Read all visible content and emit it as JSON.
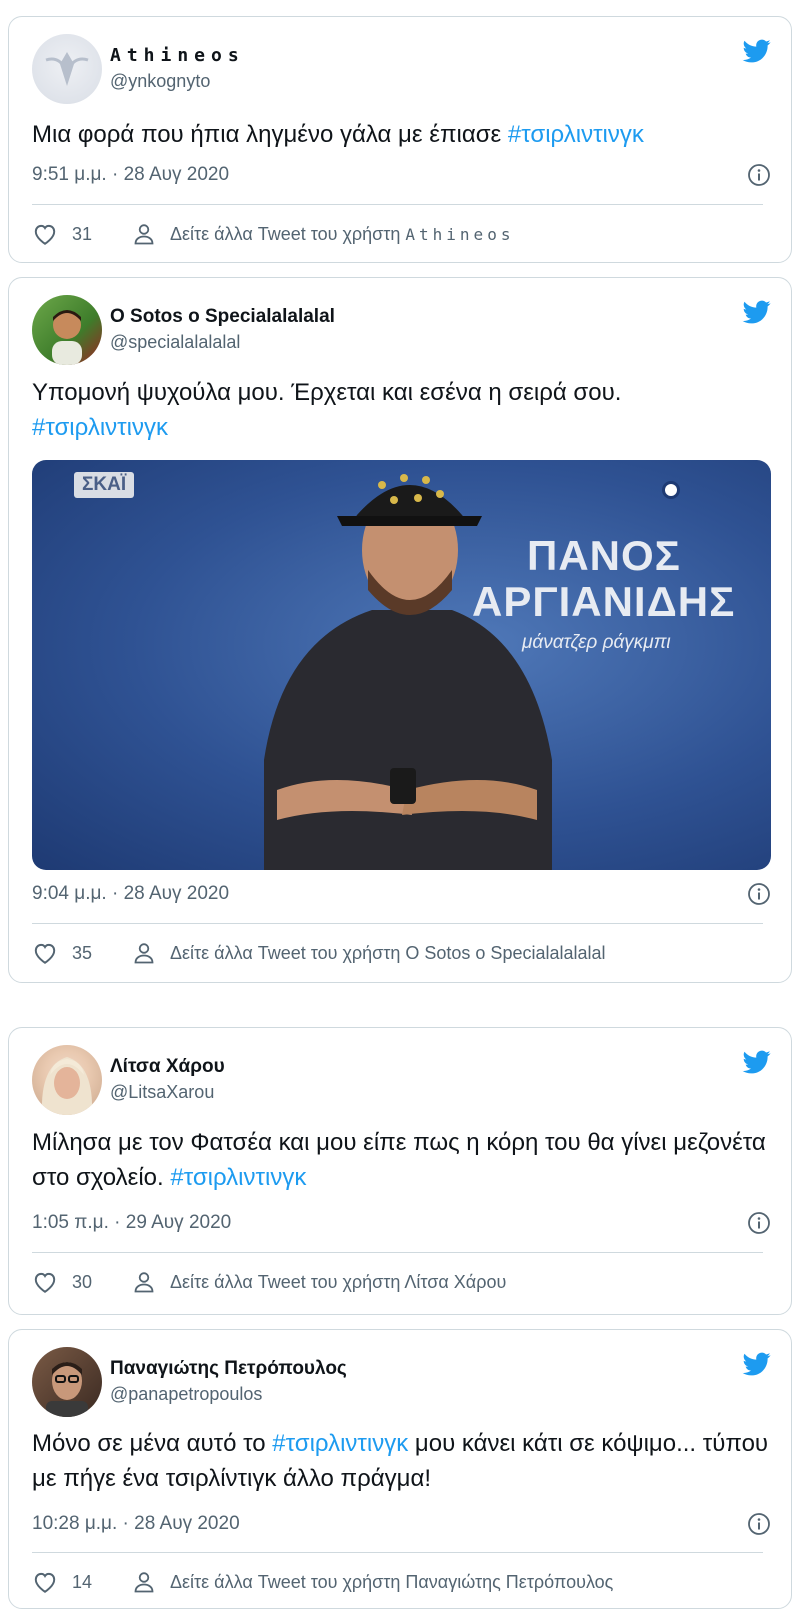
{
  "tweets": [
    {
      "name": "Athineos",
      "handle": "@ynkognyto",
      "text_before": "Μια φορά που ήπια ληγμένο γάλα με έπιασε ",
      "hashtag": "#τσιρλιντινγκ",
      "text_after": "",
      "time": "9:51 μ.μ. · 28 Αυγ 2020",
      "likes": "31",
      "more_prefix": "Δείτε άλλα Tweet του χρήστη ",
      "more_name": "Athineos"
    },
    {
      "name": "O Sotos o Specialalalalal",
      "handle": "@specialalalalal",
      "text_before": "Υπομονή ψυχούλα μου. Έρχεται και εσένα η σειρά σου.",
      "hashtag": "#τσιρλιντινγκ",
      "text_after": "",
      "media": {
        "channel": "ΣΚΑΪ",
        "title_line1": "ΠΑΝΟΣ",
        "title_line2": "ΑΡΓΙΑΝΙΔΗΣ",
        "subtitle": "μάνατζερ ράγκμπι"
      },
      "time": "9:04 μ.μ. · 28 Αυγ 2020",
      "likes": "35",
      "more_prefix": "Δείτε άλλα Tweet του χρήστη ",
      "more_name": "O Sotos o Specialalalalal"
    },
    {
      "name": "Λίτσα Χάρου",
      "handle": "@LitsaXarou",
      "text_before": "Μίλησα με τον Φατσέα και μου είπε πως η κόρη του θα γίνει μεζονέτα στο σχολείο. ",
      "hashtag": "#τσιρλιντινγκ",
      "text_after": "",
      "time": "1:05 π.μ. · 29 Αυγ 2020",
      "likes": "30",
      "more_prefix": "Δείτε άλλα Tweet του χρήστη ",
      "more_name": "Λίτσα Χάρου"
    },
    {
      "name": "Παναγιώτης Πετρόπουλος",
      "handle": "@panapetropoulos",
      "text_before": "Μόνο σε μένα αυτό το ",
      "hashtag": "#τσιρλιντινγκ",
      "text_after": " μου κάνει κάτι σε κόψιμο... τύπου με πήγε ένα τσιρλίντιγκ άλλο πράγμα!",
      "time": "10:28 μ.μ. · 28 Αυγ 2020",
      "likes": "14",
      "more_prefix": "Δείτε άλλα Tweet του χρήστη ",
      "more_name": "Παναγιώτης Πετρόπουλος"
    }
  ],
  "colors": {
    "accent": "#1d9bf0",
    "text": "#0f1419",
    "muted": "#536471",
    "border": "#cfd9de"
  },
  "icons": {
    "brand": "twitter-bird-icon",
    "info": "info-icon",
    "like": "heart-icon",
    "profile": "person-icon"
  }
}
